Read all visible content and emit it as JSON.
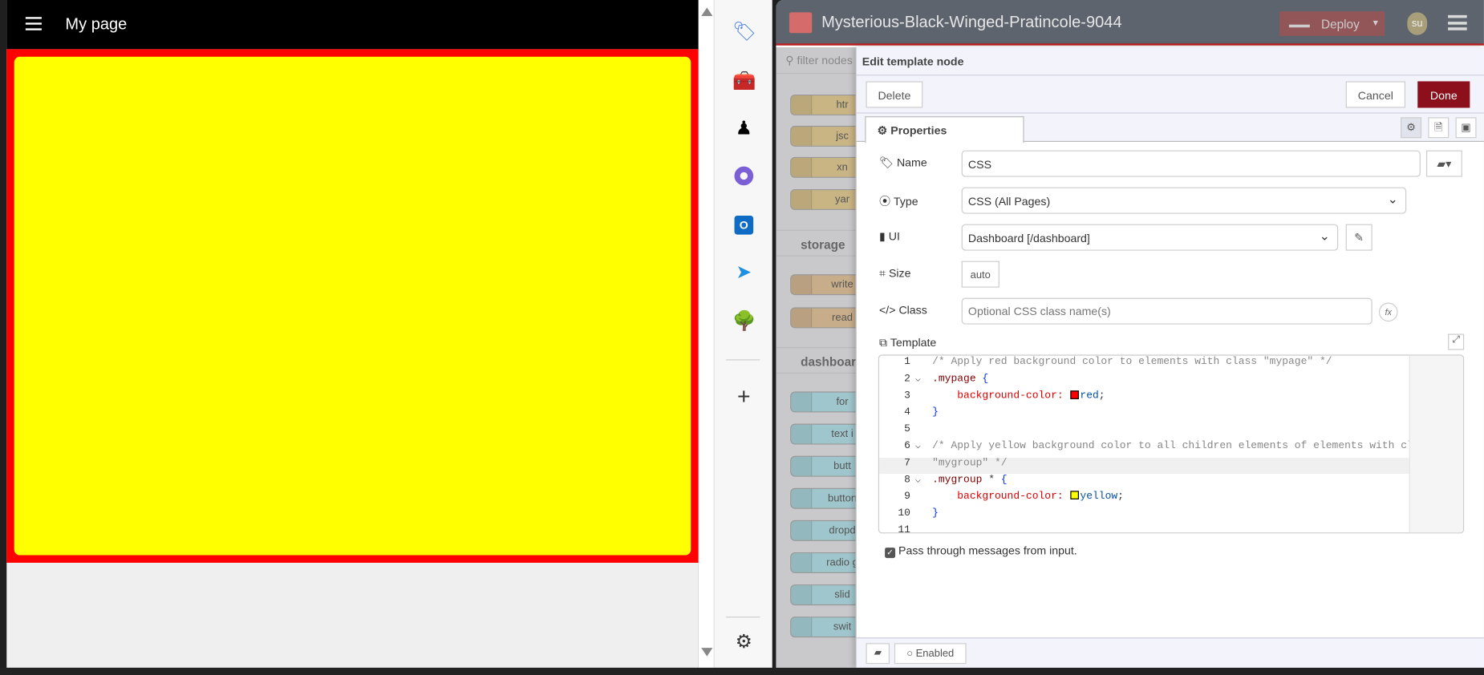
{
  "dashboard": {
    "title": "My page",
    "page_color": "#ff0000",
    "group_color": "#ffff00"
  },
  "app_strip": {
    "icons": [
      "tag-icon",
      "toolbox-icon",
      "chess-icon",
      "copilot-icon",
      "outlook-icon",
      "telegram-icon",
      "tree-icon"
    ]
  },
  "nodered": {
    "title": "Mysterious-Black-Winged-Pratincole-9044",
    "deploy_label": "Deploy",
    "user_initials": "su",
    "palette": {
      "filter_placeholder": "filter nodes",
      "top_nodes": [
        "htr",
        "jsc",
        "xn",
        "yar"
      ],
      "categories": [
        {
          "label": "storage",
          "nodes": [
            "write",
            "read"
          ]
        },
        {
          "label": "dashboard",
          "nodes": [
            "for",
            "text i",
            "butt",
            "button",
            "dropd",
            "radio g",
            "slid",
            "swit"
          ]
        }
      ]
    },
    "editor": {
      "title": "Edit template node",
      "delete_label": "Delete",
      "cancel_label": "Cancel",
      "done_label": "Done",
      "tab_label": "Properties",
      "fields": {
        "name_label": "Name",
        "name_value": "CSS",
        "type_label": "Type",
        "type_value": "CSS (All Pages)",
        "ui_label": "UI",
        "ui_value": "Dashboard [/dashboard]",
        "size_label": "Size",
        "size_value": "auto",
        "class_label": "Class",
        "class_placeholder": "Optional CSS class name(s)",
        "template_label": "Template"
      },
      "code_lines": [
        [
          {
            "c": "comment",
            "t": "/* Apply red background color to elements with class \"mypage\" */"
          }
        ],
        [
          {
            "c": "selector",
            "t": ".mypage "
          },
          {
            "c": "brace",
            "t": "{"
          }
        ],
        [
          {
            "c": "prop",
            "t": "    background-color: "
          },
          {
            "c": "swatch",
            "t": "#ff0000"
          },
          {
            "c": "value",
            "t": "red"
          },
          {
            "c": "punc",
            "t": ";"
          }
        ],
        [
          {
            "c": "brace",
            "t": "}"
          }
        ],
        [],
        [
          {
            "c": "comment",
            "t": "/* Apply yellow background color to all children elements of elements with cl"
          }
        ],
        [
          {
            "c": "comment",
            "t": "\"mygroup\" */"
          }
        ],
        [
          {
            "c": "selector",
            "t": ".mygroup "
          },
          {
            "c": "punc",
            "t": "* "
          },
          {
            "c": "brace",
            "t": "{"
          }
        ],
        [
          {
            "c": "prop",
            "t": "    background-color: "
          },
          {
            "c": "swatch",
            "t": "#ffff00"
          },
          {
            "c": "value",
            "t": "yellow"
          },
          {
            "c": "punc",
            "t": ";"
          }
        ],
        [
          {
            "c": "brace",
            "t": "}"
          }
        ],
        []
      ],
      "line_numbers": [
        "1",
        "2",
        "3",
        "4",
        "5",
        "6",
        "7",
        "8",
        "9",
        "10",
        "11"
      ],
      "foldable_lines": [
        2,
        6,
        8
      ],
      "passthrough_label": "Pass through messages from input.",
      "passthrough_checked": true,
      "enabled_label": "Enabled"
    },
    "colors": {
      "done": "#8c101c",
      "header": "#5d646e",
      "accent": "#c02020"
    }
  }
}
